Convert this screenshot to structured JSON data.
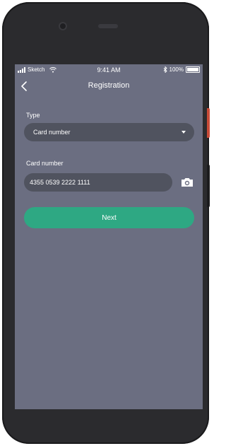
{
  "statusbar": {
    "carrier": "Sketch",
    "time": "9:41 AM",
    "battery": "100%"
  },
  "navbar": {
    "title": "Registration",
    "back_icon": "chevron-left-icon"
  },
  "form": {
    "type": {
      "label": "Type",
      "selected": "Card number",
      "icon": "caret-down-icon"
    },
    "card_number": {
      "label": "Card number",
      "value": "4355 0539 2222 1111",
      "scan_icon": "camera-icon"
    },
    "next_label": "Next"
  },
  "colors": {
    "screen_bg": "#6b6e81",
    "field_bg": "#50535f",
    "accent": "#2ea883",
    "device_frame": "#2b2b2e",
    "side_button": "#c84b38"
  }
}
